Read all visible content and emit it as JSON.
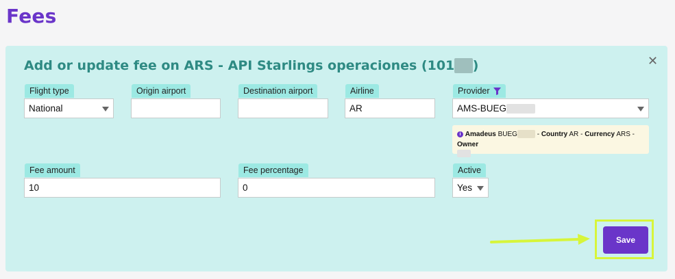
{
  "page": {
    "title": "Fees"
  },
  "panel": {
    "title_prefix": "Add or update fee on ARS - API Starlings operaciones (101",
    "title_suffix": ")",
    "close_icon": "close-icon"
  },
  "fields": {
    "flight_type": {
      "label": "Flight type",
      "value": "National"
    },
    "origin_airport": {
      "label": "Origin airport",
      "value": ""
    },
    "destination_airport": {
      "label": "Destination airport",
      "value": ""
    },
    "airline": {
      "label": "Airline",
      "value": "AR"
    },
    "provider": {
      "label": "Provider",
      "value": "AMS-BUEG",
      "icon": "filter-icon"
    },
    "fee_amount": {
      "label": "Fee amount",
      "value": "10"
    },
    "fee_percentage": {
      "label": "Fee percentage",
      "value": "0"
    },
    "active": {
      "label": "Active",
      "value": "Yes"
    }
  },
  "provider_info": {
    "provider_name": "Amadeus",
    "provider_code": "BUEG",
    "country_label": "Country",
    "country_value": "AR",
    "currency_label": "Currency",
    "currency_value": "ARS",
    "owner_label": "Owner"
  },
  "actions": {
    "save_label": "Save"
  },
  "colors": {
    "accent": "#6a35c9",
    "panel_bg": "#cdf1ef",
    "label_bg": "#9ce9e3",
    "highlight": "#d7f53a"
  }
}
